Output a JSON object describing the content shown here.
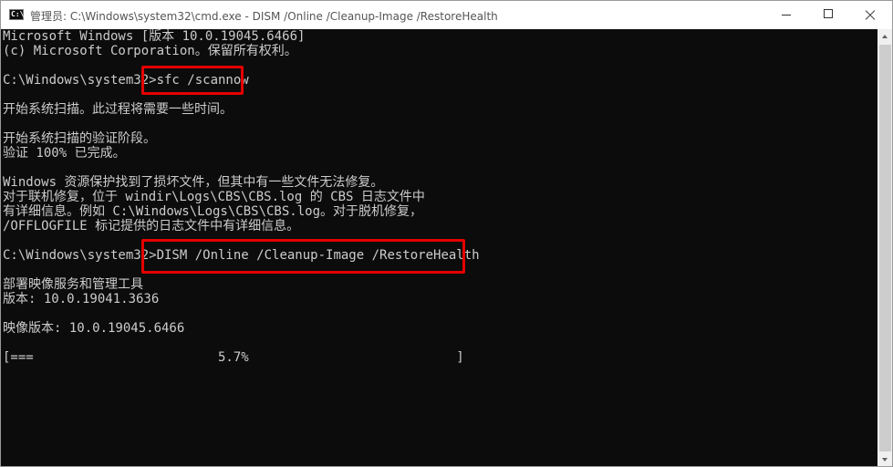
{
  "window": {
    "title": "管理员: C:\\Windows\\system32\\cmd.exe - DISM  /Online /Cleanup-Image /RestoreHealth",
    "icon": "cmd-icon",
    "icon_glyph": "C:\\",
    "controls": {
      "minimize": "minimize-icon",
      "maximize": "maximize-icon",
      "close": "close-icon"
    }
  },
  "console": {
    "header_line1": "Microsoft Windows [版本 10.0.19045.6466]",
    "header_line2": "(c) Microsoft Corporation。保留所有权利。",
    "prompt": "C:\\Windows\\system32>",
    "command1": "sfc /scannow",
    "sfc_line1": "开始系统扫描。此过程将需要一些时间。",
    "sfc_line2": "开始系统扫描的验证阶段。",
    "sfc_line3": "验证 100% 已完成。",
    "sfc_line4": "Windows 资源保护找到了损坏文件，但其中有一些文件无法修复。",
    "sfc_line5": "对于联机修复，位于 windir\\Logs\\CBS\\CBS.log 的 CBS 日志文件中",
    "sfc_line6": "有详细信息。例如 C:\\Windows\\Logs\\CBS\\CBS.log。对于脱机修复，",
    "sfc_line7": "/OFFLOGFILE 标记提供的日志文件中有详细信息。",
    "command2": "DISM /Online /Cleanup-Image /RestoreHealth",
    "dism_line1": "部署映像服务和管理工具",
    "dism_line2": "版本: 10.0.19041.3636",
    "dism_line3": "映像版本: 10.0.19045.6466",
    "progress_line": "[===                        5.7%                           ]",
    "progress_percent": 5.7
  },
  "colors": {
    "console_bg": "#0c0c0c",
    "console_text": "#cccccc",
    "highlight": "#e60000"
  }
}
